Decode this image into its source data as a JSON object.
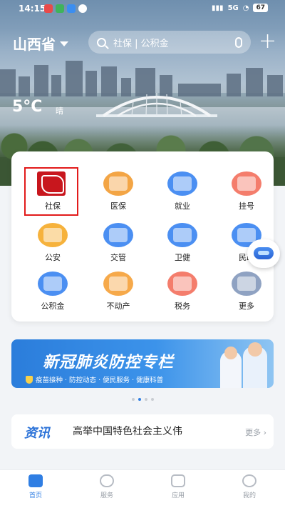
{
  "status_bar": {
    "time": "14:15",
    "network_label": "5G",
    "battery": "67"
  },
  "header": {
    "region": "山西省",
    "search_placeholder": "社保 | 公积金"
  },
  "weather": {
    "temperature": "5°C",
    "condition": "晴"
  },
  "services": [
    {
      "label": "社保",
      "icon": "shebao-logo-icon",
      "color": "#c8161d"
    },
    {
      "label": "医保",
      "icon": "medical-insurance-icon",
      "color": "#f3a545"
    },
    {
      "label": "就业",
      "icon": "briefcase-icon",
      "color": "#4b8ff2"
    },
    {
      "label": "挂号",
      "icon": "hospital-icon",
      "color": "#f47d6c"
    },
    {
      "label": "公安",
      "icon": "police-badge-icon",
      "color": "#f6b23c"
    },
    {
      "label": "交管",
      "icon": "road-icon",
      "color": "#4b8ff2"
    },
    {
      "label": "卫健",
      "icon": "heartbeat-icon",
      "color": "#4b8ff2"
    },
    {
      "label": "民政",
      "icon": "people-icon",
      "color": "#4b8ff2"
    },
    {
      "label": "公积金",
      "icon": "house-fund-icon",
      "color": "#4b8ff2"
    },
    {
      "label": "不动产",
      "icon": "property-icon",
      "color": "#f6a94a"
    },
    {
      "label": "税务",
      "icon": "tax-icon",
      "color": "#f47d6c"
    },
    {
      "label": "更多",
      "icon": "more-grid-icon",
      "color": "#8fa2c2"
    }
  ],
  "banner": {
    "title": "新冠肺炎防控专栏",
    "subtitle": "疫苗接种 · 防控动态 · 便民服务 · 健康科普"
  },
  "news": {
    "tag": "资讯",
    "headline": "高举中国特色社会主义伟",
    "more_label": "更多 ›"
  },
  "tabs": [
    {
      "label": "首页",
      "active": true
    },
    {
      "label": "服务",
      "active": false
    },
    {
      "label": "应用",
      "active": false
    },
    {
      "label": "我的",
      "active": false
    }
  ],
  "colors": {
    "accent": "#2f7ee3",
    "highlight_border": "#e21b1b"
  }
}
